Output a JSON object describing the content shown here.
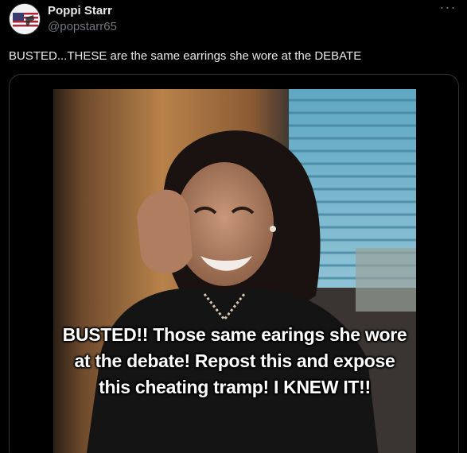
{
  "author": {
    "display_name": "Poppi Starr",
    "handle": "@popstarr65",
    "avatar_icon": "flag-avatar-icon"
  },
  "more_icon": "···",
  "post": {
    "text": "BUSTED...THESE are the same earrings she wore at the DEBATE"
  },
  "media": {
    "caption": "BUSTED!! Those same earings she wore at the debate! Repost this and expose this cheating tramp! I KNEW IT!!"
  },
  "colors": {
    "background": "#000000",
    "primary_text": "#e7e9ea",
    "secondary_text": "#71767b",
    "border": "#2f3336"
  }
}
